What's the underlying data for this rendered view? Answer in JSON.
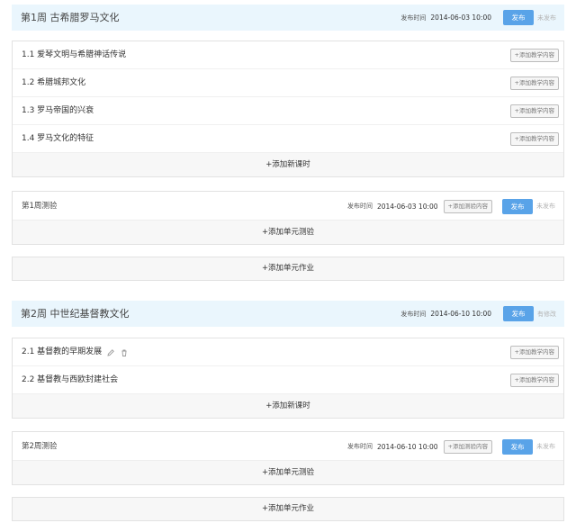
{
  "labels": {
    "publish_time_label": "发布时间",
    "publish_button": "发布",
    "add_content": "+添加教学内容",
    "add_quiz_content": "+添加测验内容",
    "add_lesson": "+添加新课时",
    "add_unit_quiz": "+添加单元测验",
    "add_unit_homework": "+添加单元作业"
  },
  "weeks": [
    {
      "title": "第1周 古希腊罗马文化",
      "publish_time": "2014-06-03 10:00",
      "status": "未发布",
      "lessons": [
        "1.1 爱琴文明与希腊神话传说",
        "1.2 希腊城邦文化",
        "1.3 罗马帝国的兴衰",
        "1.4 罗马文化的特征"
      ],
      "quiz": {
        "title": "第1周测验",
        "publish_time": "2014-06-03 10:00",
        "status": "未发布"
      }
    },
    {
      "title": "第2周 中世纪基督教文化",
      "publish_time": "2014-06-10 10:00",
      "status": "有修改",
      "lessons": [
        "2.1 基督教的早期发展",
        "2.2 基督教与西欧封建社会"
      ],
      "quiz": {
        "title": "第2周测验",
        "publish_time": "2014-06-10 10:00",
        "status": "未发布"
      }
    }
  ],
  "colors": {
    "header_bg": "#eaf6fd",
    "publish_blue": "#59a3e8",
    "status_gray": "#b4b4b4"
  },
  "icons": {
    "edit": "pencil-icon",
    "delete": "trash-icon"
  }
}
